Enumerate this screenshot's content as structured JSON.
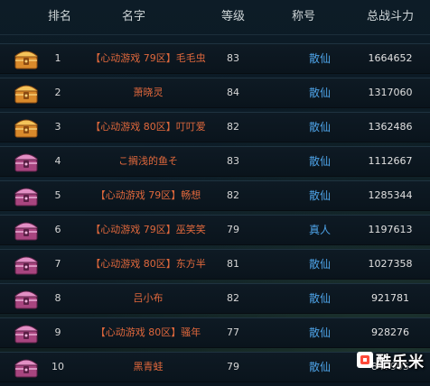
{
  "header": {
    "rank": "排名",
    "name": "名字",
    "level": "等级",
    "title": "称号",
    "power": "总战斗力"
  },
  "rows": [
    {
      "rank": "1",
      "name": "【心动游戏 79区】毛毛虫",
      "level": "83",
      "title": "散仙",
      "power": "1664652",
      "chest": "gold-chest-icon"
    },
    {
      "rank": "2",
      "name": "萧晓灵",
      "level": "84",
      "title": "散仙",
      "power": "1317060",
      "chest": "gold-chest-icon"
    },
    {
      "rank": "3",
      "name": "【心动游戏 80区】叮叮爱",
      "level": "82",
      "title": "散仙",
      "power": "1362486",
      "chest": "gold-chest-icon"
    },
    {
      "rank": "4",
      "name": "こ搁浅的鱼そ",
      "level": "83",
      "title": "散仙",
      "power": "1112667",
      "chest": "purple-chest-icon"
    },
    {
      "rank": "5",
      "name": "【心动游戏 79区】畅想",
      "level": "82",
      "title": "散仙",
      "power": "1285344",
      "chest": "purple-chest-icon"
    },
    {
      "rank": "6",
      "name": "【心动游戏 79区】巫笑笑",
      "level": "79",
      "title": "真人",
      "power": "1197613",
      "chest": "purple-chest-icon"
    },
    {
      "rank": "7",
      "name": "【心动游戏 80区】东方半",
      "level": "81",
      "title": "散仙",
      "power": "1027358",
      "chest": "purple-chest-icon"
    },
    {
      "rank": "8",
      "name": "吕小布",
      "level": "82",
      "title": "散仙",
      "power": "921781",
      "chest": "purple-chest-icon"
    },
    {
      "rank": "9",
      "name": "【心动游戏 80区】骚年",
      "level": "77",
      "title": "散仙",
      "power": "928276",
      "chest": "purple-chest-icon"
    },
    {
      "rank": "10",
      "name": "黑青蛙",
      "level": "79",
      "title": "散仙",
      "power": "847905",
      "chest": "purple-chest-icon"
    }
  ],
  "watermark": {
    "text": "酷乐米"
  },
  "colors": {
    "name": "#e0683c",
    "title": "#4da2e6",
    "gold_chest": "#d98a2b",
    "purple_chest": "#a8457f"
  }
}
